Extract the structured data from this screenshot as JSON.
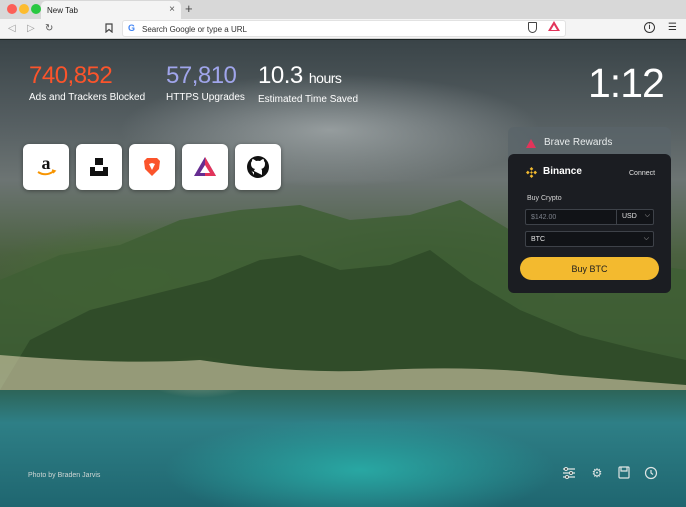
{
  "browser": {
    "tab_title": "New Tab",
    "tab_close": "×",
    "new_tab": "+",
    "url_placeholder": "Search Google or type a URL",
    "search_engine_icon": "G"
  },
  "stats": [
    {
      "value": "740,852",
      "label": "Ads and Trackers Blocked",
      "color": "#fb542b"
    },
    {
      "value": "57,810",
      "label": "HTTPS Upgrades",
      "color": "#a0a5eb"
    },
    {
      "value": "10.3",
      "unit": "hours",
      "label": "Estimated Time Saved",
      "color": "#ffffff"
    }
  ],
  "clock": "1:12",
  "top_sites": [
    {
      "name": "amazon",
      "icon": "amazon-icon"
    },
    {
      "name": "unsplash",
      "icon": "unsplash-icon"
    },
    {
      "name": "brave",
      "icon": "brave-icon"
    },
    {
      "name": "bat",
      "icon": "bat-icon"
    },
    {
      "name": "github",
      "icon": "github-icon"
    }
  ],
  "rewards": {
    "title": "Brave Rewards"
  },
  "binance": {
    "title": "Binance",
    "connect": "Connect",
    "buy_label": "Buy Crypto",
    "amount_placeholder": "$142.00",
    "currency": "USD",
    "crypto": "BTC",
    "buy_button": "Buy BTC",
    "accent": "#f3ba2f"
  },
  "photo_credit": "Photo by Braden Jarvis",
  "bottom_icons": [
    "customize-icon",
    "settings-icon",
    "bookmarks-icon",
    "history-icon"
  ]
}
